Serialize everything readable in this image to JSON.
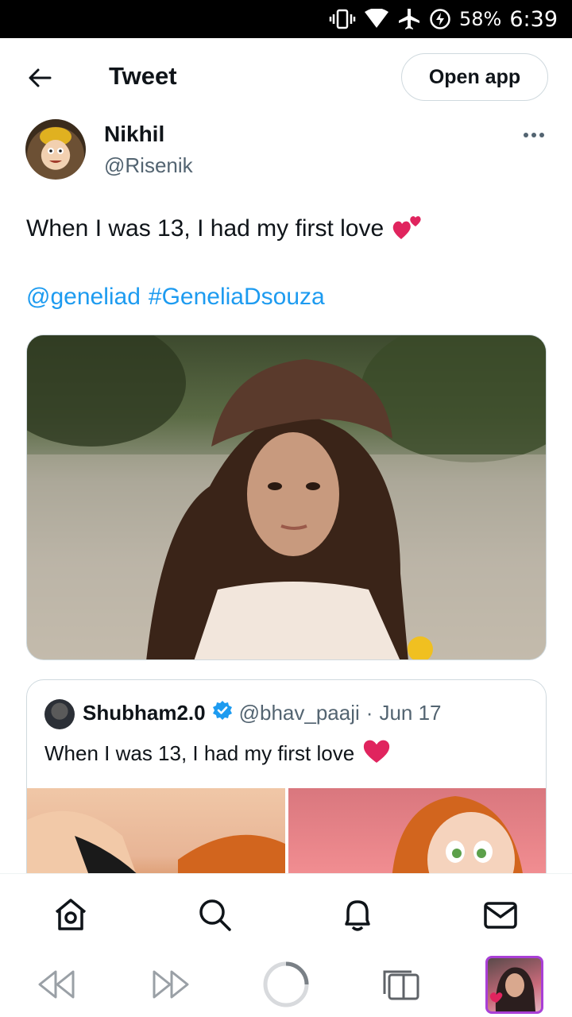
{
  "status_bar": {
    "battery": "58%",
    "time": "6:39",
    "icons": [
      "vibrate-icon",
      "wifi-icon",
      "airplane-icon",
      "battery-saver-icon"
    ]
  },
  "header": {
    "title": "Tweet",
    "open_app_label": "Open app"
  },
  "author": {
    "name": "Nikhil",
    "handle": "@Risenik"
  },
  "tweet": {
    "text": "When I was 13, I had my first love",
    "emoji": "💕",
    "mention": "@geneliad",
    "hashtag": "#GeneliaDsouza"
  },
  "quote": {
    "name": "Shubham2.0",
    "handle": "@bhav_paaji",
    "separator": "·",
    "date": "Jun 17",
    "text": "When I was 13, I had my first love",
    "emoji": "❤️"
  },
  "bottom_nav": [
    "home-icon",
    "search-icon",
    "notifications-icon",
    "messages-icon"
  ],
  "browser_bar": [
    "back-icon",
    "forward-icon",
    "reload-icon",
    "tabs-icon",
    "tab-thumbnail"
  ],
  "colors": {
    "accent": "#1d9bf0",
    "text": "#0f1419",
    "secondary": "#536471",
    "border": "#cfd9de"
  }
}
